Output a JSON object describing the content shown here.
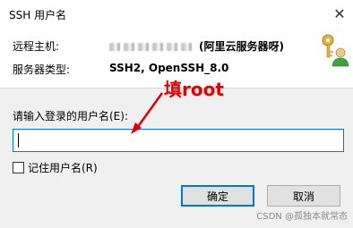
{
  "window": {
    "title": "SSH 用户名",
    "close_glyph": "✕"
  },
  "info": {
    "host_label": "远程主机:",
    "host_value": "(阿里云服务器呀)",
    "server_type_label": "服务器类型:",
    "server_type_value": "SSH2, OpenSSH_8.0"
  },
  "form": {
    "prompt": "请输入登录的用户名(E):",
    "username_value": "",
    "remember_label": "记住用户名(R)",
    "remember_checked": false
  },
  "buttons": {
    "ok": "确定",
    "cancel": "取消"
  },
  "annotation": {
    "text": "填root",
    "color": "#e00000"
  },
  "watermark": "CSDN @孤独本就常态",
  "colors": {
    "accent": "#0078d7",
    "lower_bg": "#f0f0f0"
  },
  "icons": {
    "close": "close-icon",
    "keys": "keys-user-icon"
  }
}
